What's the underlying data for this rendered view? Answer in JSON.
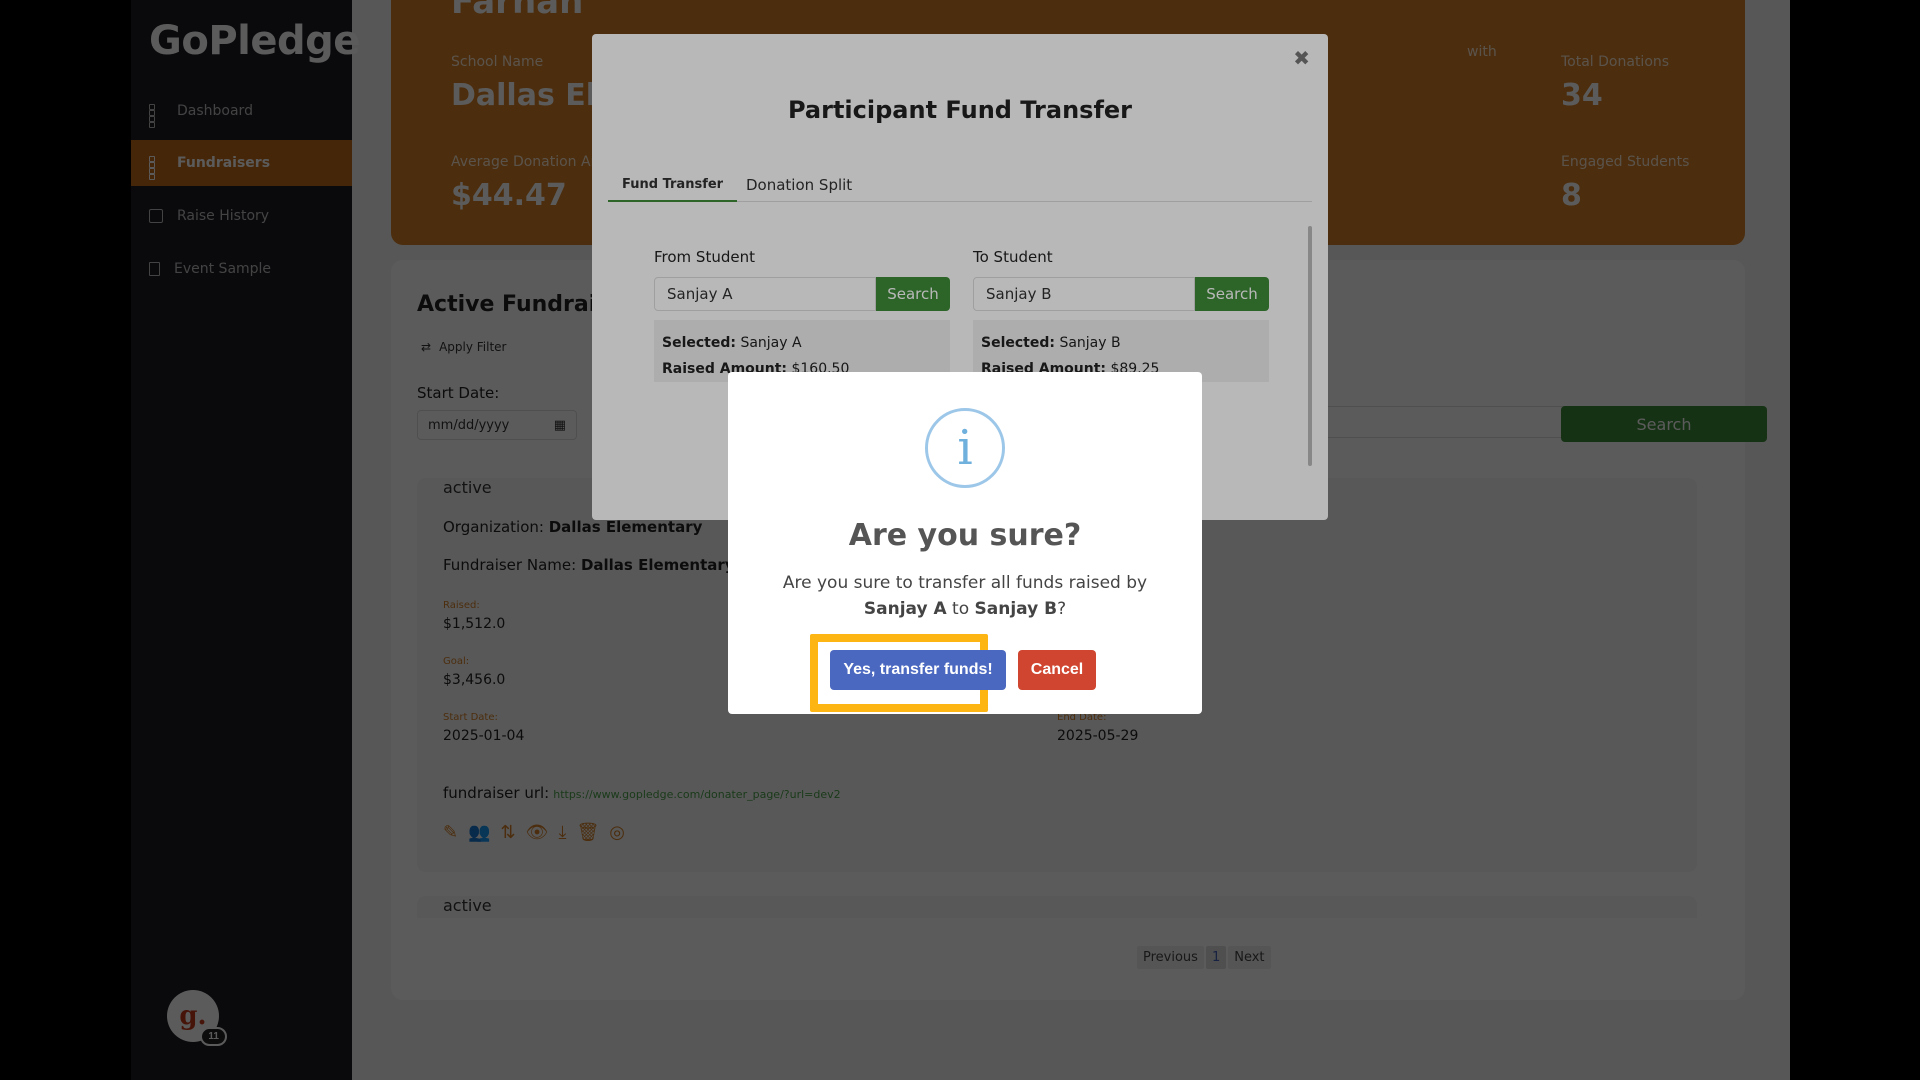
{
  "sidebar": {
    "logo": "GoPledge",
    "items": [
      {
        "label": "Dashboard"
      },
      {
        "label": "Fundraisers"
      },
      {
        "label": "Raise History"
      },
      {
        "label": "Event Sample"
      }
    ],
    "avatar_letter": "g.",
    "avatar_badge": "11"
  },
  "stats": {
    "name_partial": "Farhan",
    "school_label": "School Name",
    "school_value": "Dallas Elementary",
    "avg_label": "Average Donation Amount",
    "avg_value": "$44.47",
    "with_text": "with",
    "total_label": "Total Donations",
    "total_value": "34",
    "engaged_label": "Engaged Students",
    "engaged_value": "8"
  },
  "main": {
    "section_title": "Active Fundraisers",
    "apply_filter": "Apply Filter",
    "start_date_label": "Start Date:",
    "date_placeholder": "mm/dd/yyyy",
    "search_label": "Search",
    "fund": {
      "status": "active",
      "org_label": "Organization:",
      "org_value": "Dallas Elementary",
      "name_label": "Fundraiser Name:",
      "name_value": "Dallas Elementary Fundraiser",
      "raised_label": "Raised:",
      "raised_value": "$1,512.0",
      "goal_label": "Goal:",
      "goal_value": "$3,456.0",
      "start_label": "Start Date:",
      "start_value": "2025-01-04",
      "end_label": "End Date:",
      "end_value": "2025-05-29",
      "url_label": "fundraiser url:",
      "url_value": "https://www.gopledge.com/donater_page/?url=dev2"
    },
    "fund2_status": "active",
    "pagination": {
      "prev": "Previous",
      "current": "1",
      "next": "Next"
    }
  },
  "transfer_modal": {
    "close": "✖",
    "title": "Participant Fund Transfer",
    "tabs": [
      {
        "label": "Fund Transfer"
      },
      {
        "label": "Donation Split"
      }
    ],
    "from": {
      "label": "From Student",
      "value": "Sanjay A",
      "search": "Search",
      "selected_label": "Selected:",
      "selected_value": "Sanjay A",
      "raised_label": "Raised Amount:",
      "raised_value": "$160.50"
    },
    "to": {
      "label": "To Student",
      "value": "Sanjay B",
      "search": "Search",
      "selected_label": "Selected:",
      "selected_value": "Sanjay B",
      "raised_label": "Raised Amount:",
      "raised_value": "$89.25"
    }
  },
  "confirm_dialog": {
    "icon": "i",
    "title": "Are you sure?",
    "text_before": "Are you sure to transfer all funds raised by ",
    "from_name": "Sanjay A",
    "text_mid": " to ",
    "to_name": "Sanjay B",
    "text_end": "?",
    "confirm_label": "Yes, transfer funds!",
    "cancel_label": "Cancel"
  },
  "colors": {
    "accent": "#d47f25",
    "green": "#3f8c3a",
    "confirm": "#4b68c0",
    "cancel": "#d0452f",
    "highlight": "#fdb514"
  }
}
